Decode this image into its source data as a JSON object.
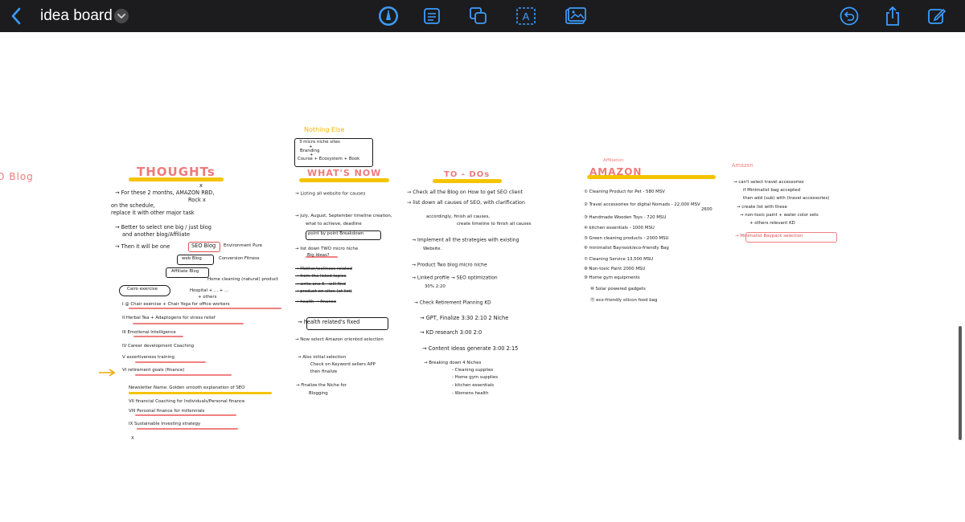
{
  "toolbar": {
    "title": "idea board",
    "bg": "#1c1c1e",
    "icons": [
      "back-chevron-icon",
      "title-dropdown-icon",
      "pen-tool-icon",
      "note-icon",
      "shapes-icon",
      "text-box-icon",
      "image-icon",
      "undo-icon",
      "share-icon",
      "edit-icon"
    ]
  },
  "board": {
    "blog": "O Blog",
    "nothing_else": {
      "title": "Nothing Else",
      "line1": "3 micro niche sites",
      "plus1": "+",
      "line2": "Branding",
      "plus2": "+",
      "line3": "Course + Ecosystem + Book"
    },
    "thoughts": {
      "heading": "THOUGHTs",
      "lines": [
        "x",
        "→ For these 2 months, AMAZON RBD,",
        "Rock x",
        "on the schedule,",
        "replace it with other major task",
        "→ Better to select one big / just blog",
        "and another blog/Affiliate",
        "→ Then it will be one",
        "SEO Blog",
        "Environment Pure",
        "web Blog",
        "Conversion Fitness",
        "Affiliate Blog",
        "Home cleaning (natural) product",
        "Cairo exercise",
        "Hospital + ... + ...",
        "+ others",
        "I   @ Chair exercise + Chair Yoga for office workers",
        "II  Herbal Tea + Adaptogens for stress relief",
        "III Emotional Intelligence",
        "IV  Career development Coaching",
        "V   assertiveness training",
        "VI  retirement goals (finance)",
        "Newsletter Name: Golden smooth explanation of SEO",
        "VII  financial Coaching for Individuals/Personal finance",
        "VIII Personal finance for millennials",
        "IX  Sustainable Investing strategy",
        "X"
      ]
    },
    "whats_now": {
      "heading": "WHAT'S NOW",
      "lines": [
        "→ Listing all website for causes",
        "→ July, August, September timeline creation,",
        "what to achieve, deadline",
        "point by point Breakdown",
        "→ list down TWO micro niche",
        "Big Ideas?",
        "→ Mother/wellness related",
        "→ from the listed topics",
        "→ write one 5 - will find",
        "→ product on sites (at list)",
        "→ health → finance",
        "→ health related's fixed",
        "→ Now select Amazon oriented selection",
        "→ Also initial selection",
        "Check on Keyword sellers APP",
        "then finalize",
        "→ Finalize the Niche for",
        "Blogging"
      ]
    },
    "todo": {
      "heading": "TO - DOs",
      "lines": [
        "→ Check all the Blog on How to get SEO client",
        "→ list down all causes of SEO, with clarification",
        "accordingly, finish all causes,",
        "create timeline to finish all causes",
        "→ Implement all the strategies with existing",
        "Website.",
        "→ Product Two blog micro niche",
        "→ Linked profile → SEO optimization",
        "30% 2:20",
        "→ Check Retirement Planning KD",
        "→ GPT, Finalize 3:30 2:10 2 Niche",
        "→ KD research 3:00 2:0",
        "→ Content Ideas generate 3:00 2:15",
        "→ Breaking down 4 Niches",
        "- Cleaning supplies",
        "- Home gym supplies",
        "- kitchen essentials",
        "- Womens health"
      ]
    },
    "amazon": {
      "affiliation": "Affiliation",
      "heading": "AMAZON",
      "lines": [
        "① Cleaning Product for Pet - 580 MSV",
        "② Travel accessories for digital Nomads - 22,000 MSV",
        "2600",
        "③ Handmade Wooden Toys - 720 MSU",
        "④ kitchen essentials - 1000 MSU",
        "⑤ Green cleaning products - 2000 MSU",
        "⑥ minimalist Baynook/eco-friendly Bag",
        "⑦ Cleaning Service  13,500 MSU",
        "⑧ Non-toxic Paint  2000 MSU",
        "⑨ Home gym equipments",
        "⑩ Solar powered gadgets",
        "⑪ eco-friendly silicon food bag"
      ]
    },
    "amazon_notes": {
      "heading": "Amazon",
      "lines": [
        "→ can't select travel accessories",
        "if Minimalist bag accepted",
        "then add (sub) with (travel accessories)",
        "→ create list with these",
        "→ non-toxic paint + water color sets",
        "+ others relevant KD",
        "→ Minimalist Baypack selection"
      ]
    },
    "colors": {
      "highlight": "#f5c400",
      "pink": "#f08080",
      "orange_arrow": "#f0a500",
      "ink": "#1a1a1a"
    }
  }
}
